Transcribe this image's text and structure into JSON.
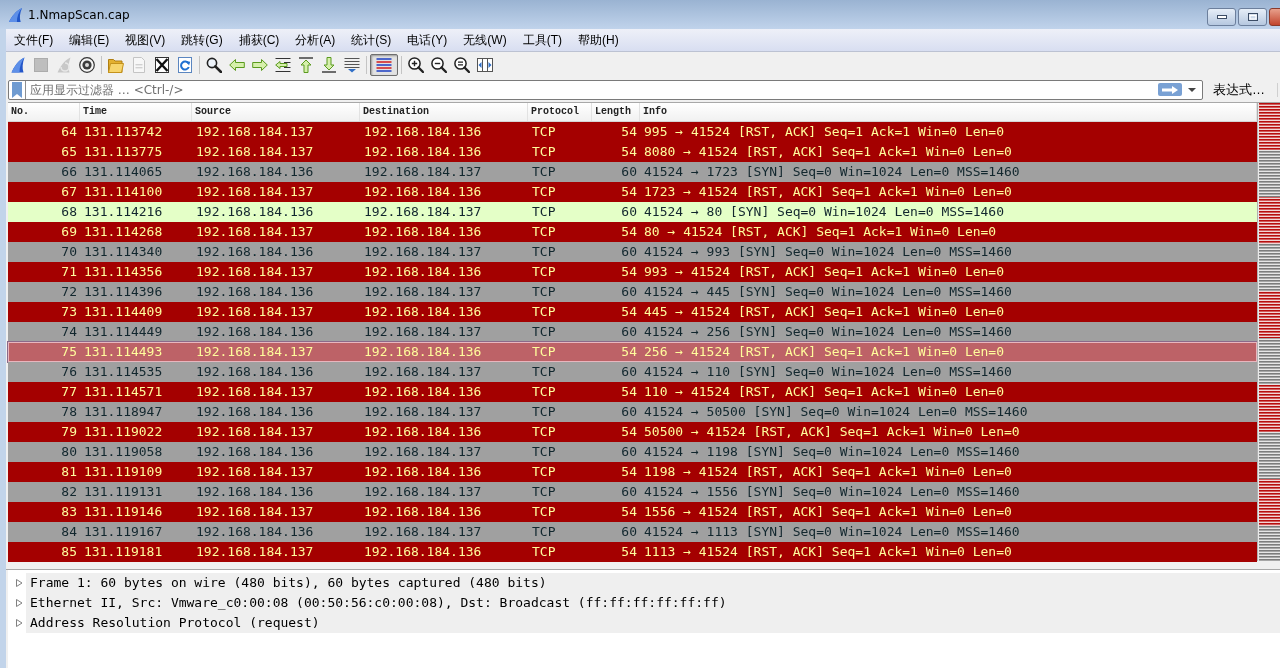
{
  "window": {
    "title": "1.NmapScan.cap"
  },
  "menu": [
    "文件(F)",
    "编辑(E)",
    "视图(V)",
    "跳转(G)",
    "捕获(C)",
    "分析(A)",
    "统计(S)",
    "电话(Y)",
    "无线(W)",
    "工具(T)",
    "帮助(H)"
  ],
  "toolbar": [
    [
      {
        "kind": "start",
        "disabled": false,
        "pressed": false
      },
      {
        "kind": "stop",
        "disabled": true,
        "pressed": false
      },
      {
        "kind": "restart",
        "disabled": true,
        "pressed": false
      },
      {
        "kind": "options",
        "disabled": false,
        "pressed": false
      }
    ],
    [
      {
        "kind": "open",
        "disabled": false,
        "pressed": false
      },
      {
        "kind": "save",
        "disabled": true,
        "pressed": false
      },
      {
        "kind": "close",
        "disabled": false,
        "pressed": false
      },
      {
        "kind": "reload",
        "disabled": false,
        "pressed": false
      }
    ],
    [
      {
        "kind": "find",
        "disabled": false,
        "pressed": false
      },
      {
        "kind": "back",
        "disabled": false,
        "pressed": false
      },
      {
        "kind": "forward",
        "disabled": false,
        "pressed": false
      },
      {
        "kind": "goto",
        "disabled": false,
        "pressed": false
      },
      {
        "kind": "first",
        "disabled": false,
        "pressed": false
      },
      {
        "kind": "last",
        "disabled": false,
        "pressed": false
      },
      {
        "kind": "autoscroll",
        "disabled": false,
        "pressed": false
      }
    ],
    [
      {
        "kind": "colorize",
        "disabled": false,
        "pressed": true
      }
    ],
    [
      {
        "kind": "zoom-in",
        "disabled": false,
        "pressed": false
      },
      {
        "kind": "zoom-out",
        "disabled": false,
        "pressed": false
      },
      {
        "kind": "zoom-reset",
        "disabled": false,
        "pressed": false
      },
      {
        "kind": "resize",
        "disabled": false,
        "pressed": false
      }
    ]
  ],
  "filter": {
    "placeholder": "应用显示过滤器 … <Ctrl-/>",
    "expression_button": "表达式…"
  },
  "packet_list": {
    "columns": [
      "No.",
      "Time",
      "Source",
      "Destination",
      "Protocol",
      "Length",
      "Info"
    ],
    "rows": [
      {
        "no": "64",
        "time": "131.113742",
        "source": "192.168.184.137",
        "destination": "192.168.184.136",
        "protocol": "TCP",
        "length": "54",
        "info": "995 → 41524 [RST, ACK] Seq=1 Ack=1 Win=0 Len=0",
        "color": "#a40000",
        "selected": false
      },
      {
        "no": "65",
        "time": "131.113775",
        "source": "192.168.184.137",
        "destination": "192.168.184.136",
        "protocol": "TCP",
        "length": "54",
        "info": "8080 → 41524 [RST, ACK] Seq=1 Ack=1 Win=0 Len=0",
        "color": "#a40000",
        "selected": false
      },
      {
        "no": "66",
        "time": "131.114065",
        "source": "192.168.184.136",
        "destination": "192.168.184.137",
        "protocol": "TCP",
        "length": "60",
        "info": "41524 → 1723 [SYN] Seq=0 Win=1024 Len=0 MSS=1460",
        "color": "#a0a0a0",
        "selected": false
      },
      {
        "no": "67",
        "time": "131.114100",
        "source": "192.168.184.137",
        "destination": "192.168.184.136",
        "protocol": "TCP",
        "length": "54",
        "info": "1723 → 41524 [RST, ACK] Seq=1 Ack=1 Win=0 Len=0",
        "color": "#a40000",
        "selected": false
      },
      {
        "no": "68",
        "time": "131.114216",
        "source": "192.168.184.136",
        "destination": "192.168.184.137",
        "protocol": "TCP",
        "length": "60",
        "info": "41524 → 80 [SYN] Seq=0 Win=1024 Len=0 MSS=1460",
        "color": "#e4ffc7",
        "selected": false
      },
      {
        "no": "69",
        "time": "131.114268",
        "source": "192.168.184.137",
        "destination": "192.168.184.136",
        "protocol": "TCP",
        "length": "54",
        "info": "80 → 41524 [RST, ACK] Seq=1 Ack=1 Win=0 Len=0",
        "color": "#a40000",
        "selected": false
      },
      {
        "no": "70",
        "time": "131.114340",
        "source": "192.168.184.136",
        "destination": "192.168.184.137",
        "protocol": "TCP",
        "length": "60",
        "info": "41524 → 993 [SYN] Seq=0 Win=1024 Len=0 MSS=1460",
        "color": "#a0a0a0",
        "selected": false
      },
      {
        "no": "71",
        "time": "131.114356",
        "source": "192.168.184.137",
        "destination": "192.168.184.136",
        "protocol": "TCP",
        "length": "54",
        "info": "993 → 41524 [RST, ACK] Seq=1 Ack=1 Win=0 Len=0",
        "color": "#a40000",
        "selected": false
      },
      {
        "no": "72",
        "time": "131.114396",
        "source": "192.168.184.136",
        "destination": "192.168.184.137",
        "protocol": "TCP",
        "length": "60",
        "info": "41524 → 445 [SYN] Seq=0 Win=1024 Len=0 MSS=1460",
        "color": "#a0a0a0",
        "selected": false
      },
      {
        "no": "73",
        "time": "131.114409",
        "source": "192.168.184.137",
        "destination": "192.168.184.136",
        "protocol": "TCP",
        "length": "54",
        "info": "445 → 41524 [RST, ACK] Seq=1 Ack=1 Win=0 Len=0",
        "color": "#a40000",
        "selected": false
      },
      {
        "no": "74",
        "time": "131.114449",
        "source": "192.168.184.136",
        "destination": "192.168.184.137",
        "protocol": "TCP",
        "length": "60",
        "info": "41524 → 256 [SYN] Seq=0 Win=1024 Len=0 MSS=1460",
        "color": "#a0a0a0",
        "selected": false
      },
      {
        "no": "75",
        "time": "131.114493",
        "source": "192.168.184.137",
        "destination": "192.168.184.136",
        "protocol": "TCP",
        "length": "54",
        "info": "256 → 41524 [RST, ACK] Seq=1 Ack=1 Win=0 Len=0",
        "color": "#bd6267",
        "selected": true
      },
      {
        "no": "76",
        "time": "131.114535",
        "source": "192.168.184.136",
        "destination": "192.168.184.137",
        "protocol": "TCP",
        "length": "60",
        "info": "41524 → 110 [SYN] Seq=0 Win=1024 Len=0 MSS=1460",
        "color": "#a0a0a0",
        "selected": false
      },
      {
        "no": "77",
        "time": "131.114571",
        "source": "192.168.184.137",
        "destination": "192.168.184.136",
        "protocol": "TCP",
        "length": "54",
        "info": "110 → 41524 [RST, ACK] Seq=1 Ack=1 Win=0 Len=0",
        "color": "#a40000",
        "selected": false
      },
      {
        "no": "78",
        "time": "131.118947",
        "source": "192.168.184.136",
        "destination": "192.168.184.137",
        "protocol": "TCP",
        "length": "60",
        "info": "41524 → 50500 [SYN] Seq=0 Win=1024 Len=0 MSS=1460",
        "color": "#a0a0a0",
        "selected": false
      },
      {
        "no": "79",
        "time": "131.119022",
        "source": "192.168.184.137",
        "destination": "192.168.184.136",
        "protocol": "TCP",
        "length": "54",
        "info": "50500 → 41524 [RST, ACK] Seq=1 Ack=1 Win=0 Len=0",
        "color": "#a40000",
        "selected": false
      },
      {
        "no": "80",
        "time": "131.119058",
        "source": "192.168.184.136",
        "destination": "192.168.184.137",
        "protocol": "TCP",
        "length": "60",
        "info": "41524 → 1198 [SYN] Seq=0 Win=1024 Len=0 MSS=1460",
        "color": "#a0a0a0",
        "selected": false
      },
      {
        "no": "81",
        "time": "131.119109",
        "source": "192.168.184.137",
        "destination": "192.168.184.136",
        "protocol": "TCP",
        "length": "54",
        "info": "1198 → 41524 [RST, ACK] Seq=1 Ack=1 Win=0 Len=0",
        "color": "#a40000",
        "selected": false
      },
      {
        "no": "82",
        "time": "131.119131",
        "source": "192.168.184.136",
        "destination": "192.168.184.137",
        "protocol": "TCP",
        "length": "60",
        "info": "41524 → 1556 [SYN] Seq=0 Win=1024 Len=0 MSS=1460",
        "color": "#a0a0a0",
        "selected": false
      },
      {
        "no": "83",
        "time": "131.119146",
        "source": "192.168.184.137",
        "destination": "192.168.184.136",
        "protocol": "TCP",
        "length": "54",
        "info": "1556 → 41524 [RST, ACK] Seq=1 Ack=1 Win=0 Len=0",
        "color": "#a40000",
        "selected": false
      },
      {
        "no": "84",
        "time": "131.119167",
        "source": "192.168.184.136",
        "destination": "192.168.184.137",
        "protocol": "TCP",
        "length": "60",
        "info": "41524 → 1113 [SYN] Seq=0 Win=1024 Len=0 MSS=1460",
        "color": "#a0a0a0",
        "selected": false
      },
      {
        "no": "85",
        "time": "131.119181",
        "source": "192.168.184.137",
        "destination": "192.168.184.136",
        "protocol": "TCP",
        "length": "54",
        "info": "1113 → 41524 [RST, ACK] Seq=1 Ack=1 Win=0 Len=0",
        "color": "#a40000",
        "selected": false
      }
    ]
  },
  "packet_details": [
    {
      "label": "Frame 1: 60 bytes on wire (480 bits), 60 bytes captured (480 bits)",
      "expanded": false
    },
    {
      "label": "Ethernet II, Src: Vmware_c0:00:08 (00:50:56:c0:00:08), Dst: Broadcast (ff:ff:ff:ff:ff:ff)",
      "expanded": false
    },
    {
      "label": "Address Resolution Protocol (request)",
      "expanded": false
    }
  ]
}
